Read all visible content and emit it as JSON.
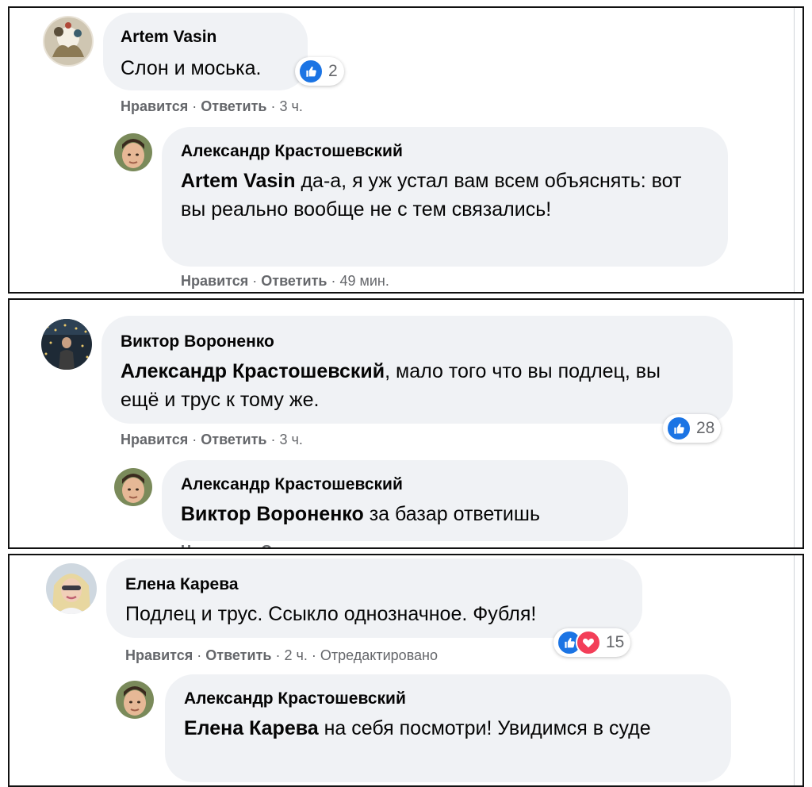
{
  "actions": {
    "like": "Нравится",
    "reply": "Ответить",
    "sep": "·"
  },
  "panels": [
    {
      "comment": {
        "author": "Artem Vasin",
        "text": "Слон и моська.",
        "time": "3 ч.",
        "reactions": {
          "count": "2",
          "types": [
            "like"
          ]
        }
      },
      "reply": {
        "author": "Александр Крастошевский",
        "mention": "Artem Vasin",
        "text": " да-а, я уж устал вам всем объяснять: вот вы реально вообще не с тем связались!",
        "time": "49 мин."
      }
    },
    {
      "comment": {
        "author": "Виктор Вороненко",
        "mention": "Александр Крастошевский",
        "text": ", мало того что вы подлец, вы ещё и трус к тому же.",
        "time": "3 ч.",
        "reactions": {
          "count": "28",
          "types": [
            "like"
          ]
        }
      },
      "reply": {
        "author": "Александр Крастошевский",
        "mention": "Виктор Вороненко",
        "text": " за базар ответишь"
      }
    },
    {
      "comment": {
        "author": "Елена Карева",
        "text": "Подлец и трус. Ссыкло однозначное. Фубля!",
        "time": "2 ч.",
        "edited": "Отредактировано",
        "reactions": {
          "count": "15",
          "types": [
            "like",
            "love"
          ]
        }
      },
      "reply": {
        "author": "Александр Крастошевский",
        "mention": "Елена Карева",
        "text": " на себя посмотри! Увидимся в суде"
      }
    }
  ],
  "colors": {
    "bubble": "#f0f2f5",
    "meta": "#65676b",
    "like": "#1b74e4",
    "love": "#f33e58"
  }
}
